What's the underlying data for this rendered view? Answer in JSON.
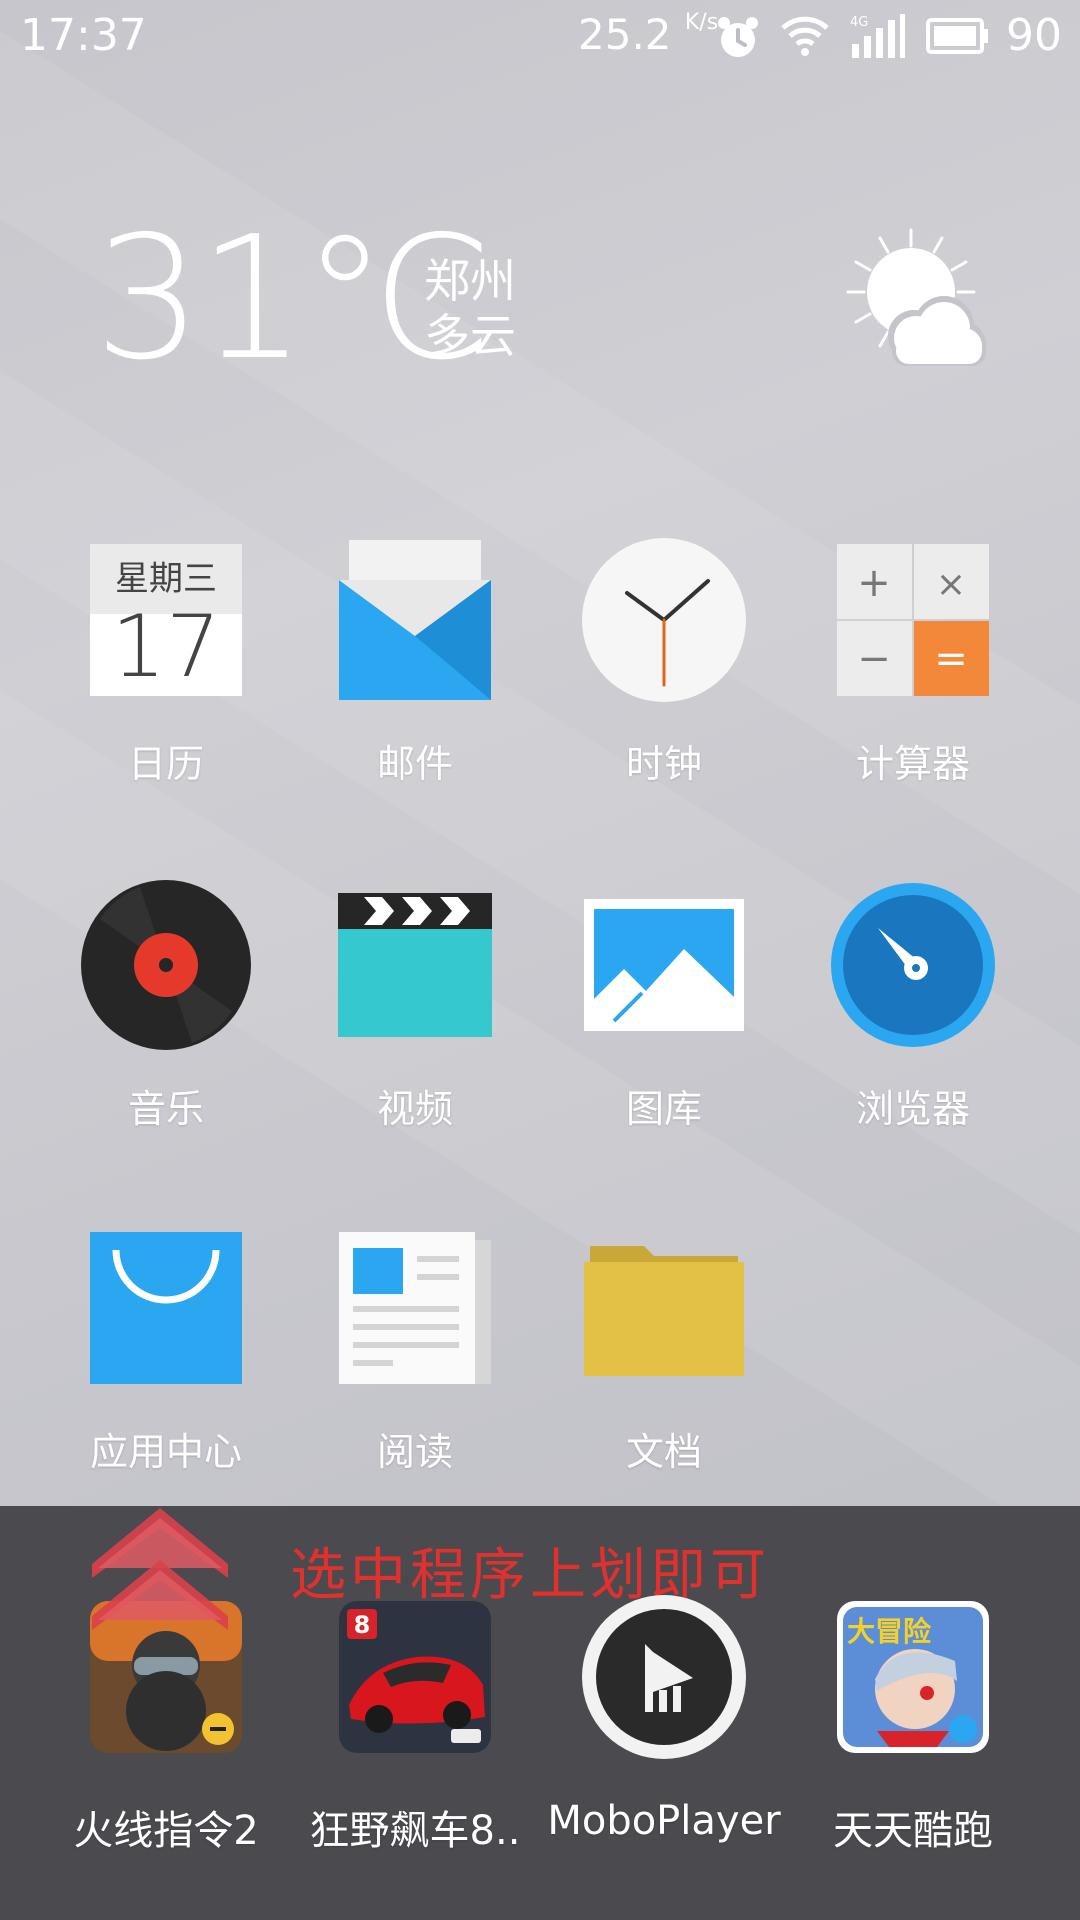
{
  "status_bar": {
    "time": "17:37",
    "net_speed": "25.2",
    "net_speed_unit": "K/s",
    "battery": "90",
    "icons": [
      "alarm-icon",
      "wifi-icon",
      "signal-4g-icon",
      "battery-icon"
    ]
  },
  "weather": {
    "temperature": "31℃",
    "city": "郑州",
    "condition": "多云",
    "icon": "partly-cloudy-icon"
  },
  "calendar_widget": {
    "weekday": "星期三",
    "day": "17"
  },
  "apps": [
    {
      "label": "日历",
      "icon": "calendar-icon"
    },
    {
      "label": "邮件",
      "icon": "mail-icon"
    },
    {
      "label": "时钟",
      "icon": "clock-icon"
    },
    {
      "label": "计算器",
      "icon": "calculator-icon"
    },
    {
      "label": "音乐",
      "icon": "music-icon"
    },
    {
      "label": "视频",
      "icon": "video-icon"
    },
    {
      "label": "图库",
      "icon": "gallery-icon"
    },
    {
      "label": "浏览器",
      "icon": "browser-icon"
    },
    {
      "label": "应用中心",
      "icon": "app-center-icon"
    },
    {
      "label": "阅读",
      "icon": "reader-icon"
    },
    {
      "label": "文档",
      "icon": "folder-icon"
    }
  ],
  "calculator_keys": [
    "+",
    "×",
    "−",
    "="
  ],
  "dock": {
    "hint": "选中程序上划即可",
    "apps": [
      {
        "label": "火线指令2",
        "icon": "game-shooter-icon"
      },
      {
        "label": "狂野飙车8..",
        "icon": "game-racing-icon",
        "badge": "8"
      },
      {
        "label": "MoboPlayer",
        "icon": "moboplayer-icon"
      },
      {
        "label": "天天酷跑",
        "icon": "game-runner-icon",
        "badge": "大冒险"
      }
    ]
  },
  "colors": {
    "accent_blue": "#2aa7f0",
    "calc_orange": "#f4883a",
    "folder_yellow": "#e2c145",
    "video_teal": "#36c8cf",
    "hint_red": "#e0312f"
  }
}
